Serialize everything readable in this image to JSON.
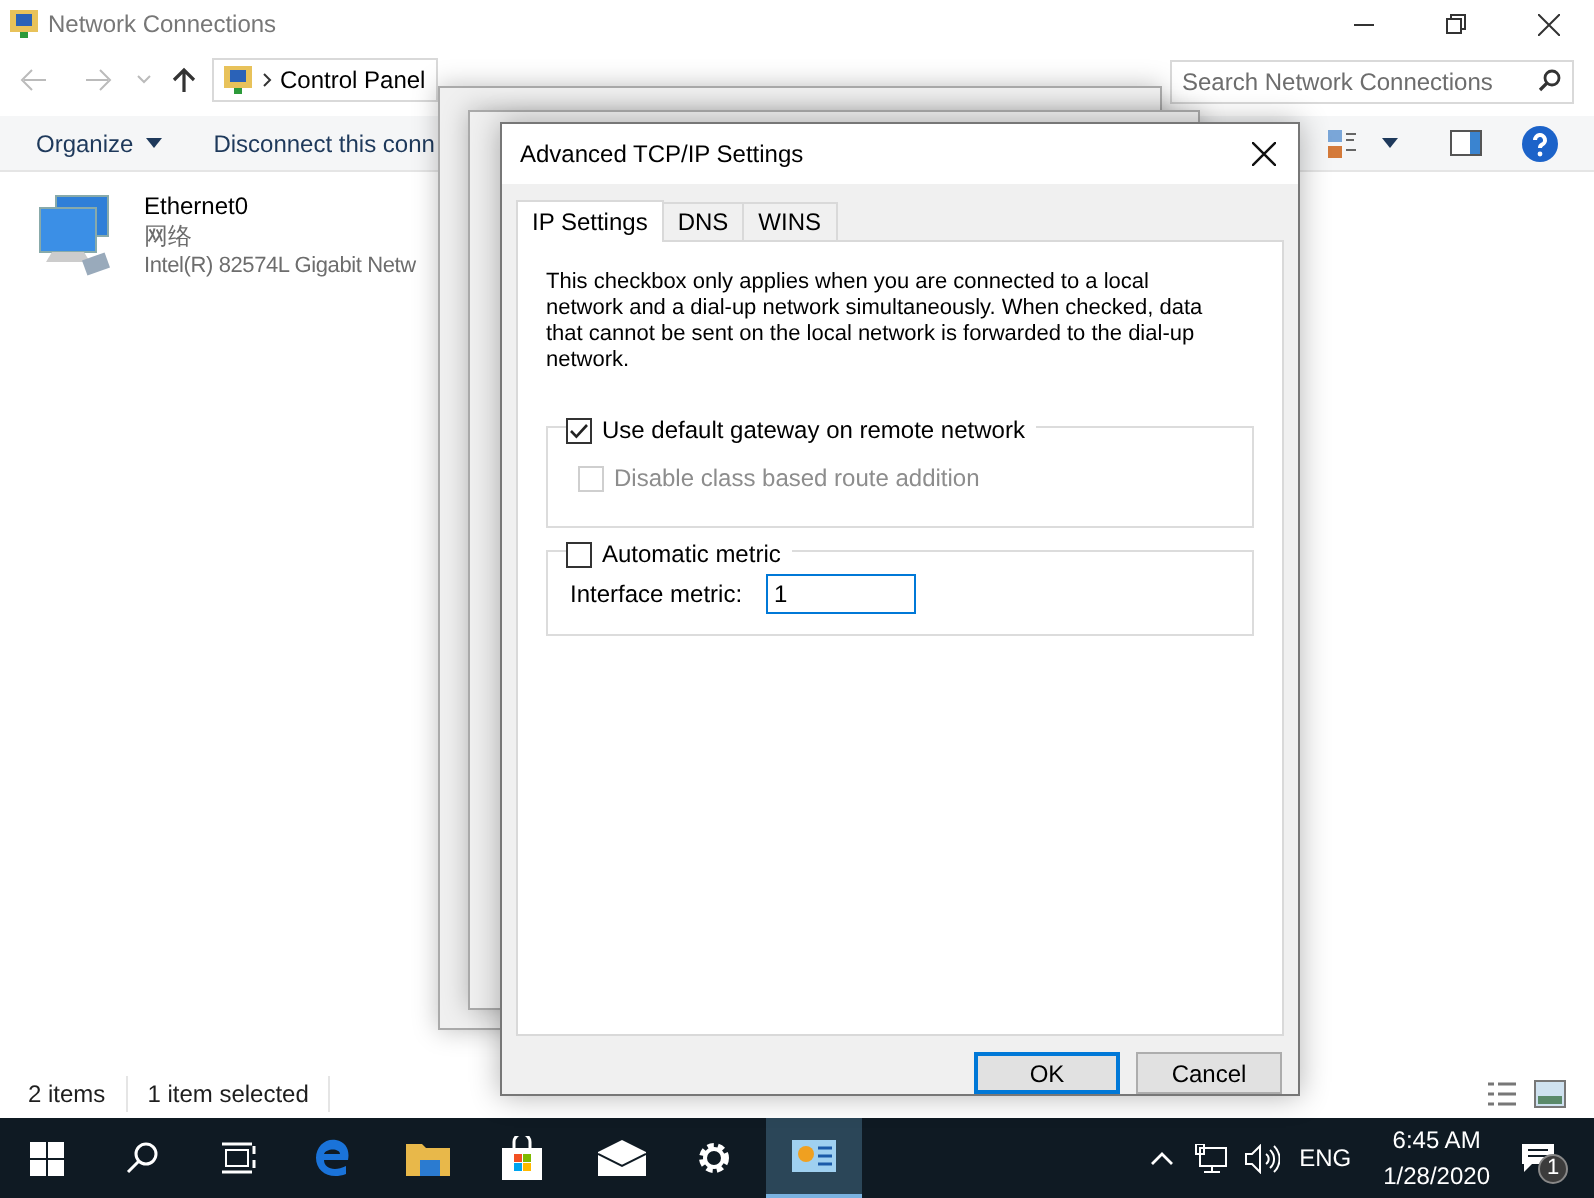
{
  "window": {
    "title": "Network Connections"
  },
  "address_bar": {
    "breadcrumbs": [
      "Control Panel"
    ]
  },
  "search": {
    "placeholder": "Search Network Connections"
  },
  "toolbar": {
    "items": [
      "Organize",
      "Disconnect this conn"
    ]
  },
  "connections": [
    {
      "name": "Ethernet0",
      "network": "网络",
      "adapter": "Intel(R) 82574L Gigabit Netw",
      "selected": false
    }
  ],
  "status_bar": {
    "items": [
      "2 items",
      "1 item selected"
    ]
  },
  "dialog": {
    "title": "Advanced TCP/IP Settings",
    "tabs": [
      {
        "label": "IP Settings",
        "selected": true
      },
      {
        "label": "DNS",
        "selected": false
      },
      {
        "label": "WINS",
        "selected": false
      }
    ],
    "description": "This checkbox only applies when you are connected to a local network and a dial-up network simultaneously.  When checked, data that cannot be sent on the local network is forwarded to the dial-up network.",
    "gateway_group": {
      "checkbox": {
        "label": "Use default gateway on remote network",
        "checked": true,
        "disabled": false
      },
      "sub_checkbox": {
        "label": "Disable class based route addition",
        "checked": false,
        "disabled": true
      }
    },
    "metric_group": {
      "checkbox": {
        "label": "Automatic metric",
        "checked": false,
        "disabled": false
      },
      "field": {
        "label": "Interface metric:",
        "value": "1"
      }
    },
    "buttons": [
      {
        "label": "OK",
        "default": true
      },
      {
        "label": "Cancel",
        "default": false
      }
    ]
  },
  "taskbar": {
    "language": "ENG",
    "time": "6:45 AM",
    "date": "1/28/2020",
    "notification_count": "1"
  }
}
